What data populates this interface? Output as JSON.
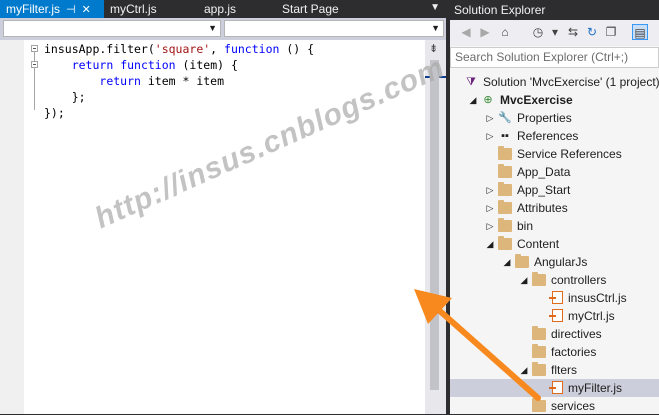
{
  "editor": {
    "tabs": [
      {
        "label": "myFilter.js",
        "active": true,
        "pin_icon": "pin-icon",
        "close_icon": "close-icon"
      },
      {
        "label": "myCtrl.js",
        "active": false
      },
      {
        "label": "app.js",
        "active": false
      },
      {
        "label": "Start Page",
        "active": false
      }
    ],
    "code_lines": {
      "l1_a": "insusApp.filter(",
      "l1_str": "'square'",
      "l1_b": ", ",
      "l1_kw": "function",
      "l1_c": " () {",
      "l2_kw1": "return",
      "l2_kw2": "function",
      "l2_b": " (item) {",
      "l3_kw": "return",
      "l3_b": " item * item",
      "l4": "};",
      "l5": "});"
    }
  },
  "solution_explorer": {
    "title": "Solution Explorer",
    "search_placeholder": "Search Solution Explorer (Ctrl+;)",
    "tree": [
      {
        "label": "Solution 'MvcExercise' (1 project)",
        "depth": 0,
        "expander": "none",
        "icon": "solution-icon"
      },
      {
        "label": "MvcExercise",
        "depth": 1,
        "expander": "expanded",
        "icon": "project-icon",
        "bold": true
      },
      {
        "label": "Properties",
        "depth": 2,
        "expander": "collapsed",
        "icon": "wrench-icon"
      },
      {
        "label": "References",
        "depth": 2,
        "expander": "collapsed",
        "icon": "references-icon"
      },
      {
        "label": "Service References",
        "depth": 2,
        "expander": "none",
        "icon": "folder-icon"
      },
      {
        "label": "App_Data",
        "depth": 2,
        "expander": "none",
        "icon": "folder-icon"
      },
      {
        "label": "App_Start",
        "depth": 2,
        "expander": "collapsed",
        "icon": "folder-icon"
      },
      {
        "label": "Attributes",
        "depth": 2,
        "expander": "collapsed",
        "icon": "folder-icon"
      },
      {
        "label": "bin",
        "depth": 2,
        "expander": "collapsed",
        "icon": "folder-icon"
      },
      {
        "label": "Content",
        "depth": 2,
        "expander": "expanded",
        "icon": "folder-icon"
      },
      {
        "label": "AngularJs",
        "depth": 3,
        "expander": "expanded",
        "icon": "folder-icon"
      },
      {
        "label": "controllers",
        "depth": 4,
        "expander": "expanded",
        "icon": "folder-icon"
      },
      {
        "label": "insusCtrl.js",
        "depth": 5,
        "expander": "none",
        "icon": "js-file-icon"
      },
      {
        "label": "myCtrl.js",
        "depth": 5,
        "expander": "none",
        "icon": "js-file-icon"
      },
      {
        "label": "directives",
        "depth": 4,
        "expander": "none",
        "icon": "folder-icon"
      },
      {
        "label": "factories",
        "depth": 4,
        "expander": "none",
        "icon": "folder-icon"
      },
      {
        "label": "flters",
        "depth": 4,
        "expander": "expanded",
        "icon": "folder-icon"
      },
      {
        "label": "myFilter.js",
        "depth": 5,
        "expander": "none",
        "icon": "js-file-icon",
        "selected": true
      },
      {
        "label": "services",
        "depth": 4,
        "expander": "none",
        "icon": "folder-icon"
      }
    ]
  },
  "watermark": "http://insus.cnblogs.com",
  "colors": {
    "accent": "#007acc",
    "dark_chrome": "#2d2d30",
    "keyword": "#0000ff",
    "string": "#a31515",
    "arrow": "#f7891f"
  }
}
